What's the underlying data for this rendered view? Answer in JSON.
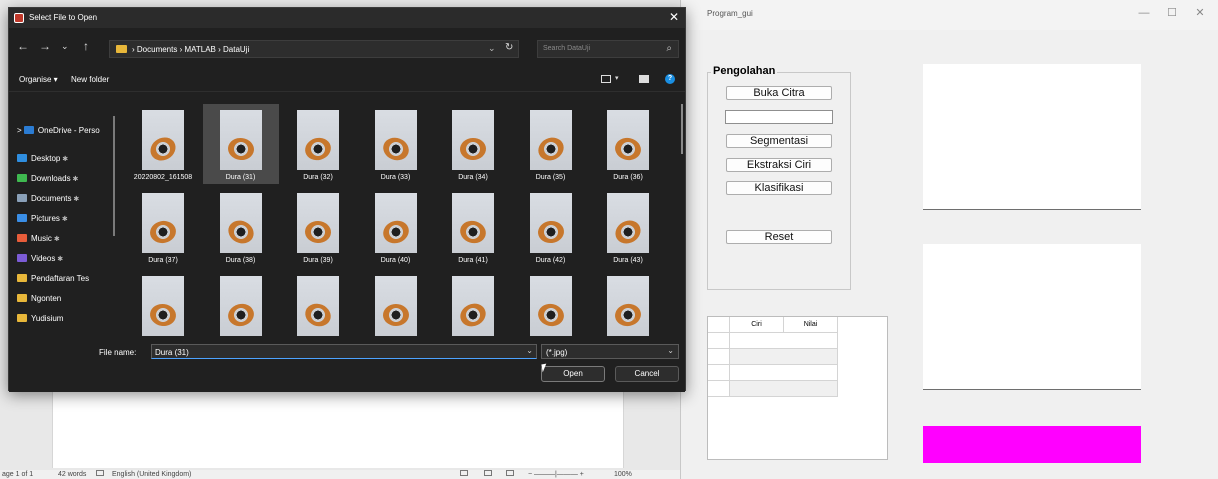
{
  "word": {
    "page_count": "age 1 of 1",
    "words": "42 words",
    "language": "English (United Kingdom)",
    "zoom": "100%"
  },
  "program": {
    "title": "Program_gui",
    "panel_title": "Pengolahan",
    "buttons": {
      "buka": "Buka Citra",
      "segmentasi": "Segmentasi",
      "ekstraksi": "Ekstraksi Ciri",
      "klasifikasi": "Klasifikasi",
      "reset": "Reset"
    },
    "table": {
      "col_ciri": "Ciri",
      "col_nilai": "Nilai"
    },
    "accent_color": "#ff00ff"
  },
  "dialog": {
    "title": "Select File to Open",
    "path": [
      "Documents",
      "MATLAB",
      "DataUji"
    ],
    "search_placeholder": "Search DataUji",
    "organise": "Organise ▾",
    "new_folder": "New folder",
    "nav_items": [
      {
        "label": "OneDrive - Perso",
        "icon": "cloud-icon",
        "color": "#2b7cd3"
      },
      {
        "label": "Desktop",
        "icon": "desktop-icon",
        "color": "#2f8ee0"
      },
      {
        "label": "Downloads",
        "icon": "download-icon",
        "color": "#3fb950"
      },
      {
        "label": "Documents",
        "icon": "document-icon",
        "color": "#8aa0b8"
      },
      {
        "label": "Pictures",
        "icon": "pictures-icon",
        "color": "#3a8ee6"
      },
      {
        "label": "Music",
        "icon": "music-icon",
        "color": "#e85d3a"
      },
      {
        "label": "Videos",
        "icon": "video-icon",
        "color": "#7c5cd6"
      },
      {
        "label": "Pendaftaran Tes",
        "icon": "folder-icon",
        "color": "#e8b73a"
      },
      {
        "label": "Ngonten",
        "icon": "folder-icon",
        "color": "#e8b73a"
      },
      {
        "label": "Yudisium",
        "icon": "folder-icon",
        "color": "#e8b73a"
      }
    ],
    "files": [
      "20220802_161508",
      "Dura (31)",
      "Dura (32)",
      "Dura (33)",
      "Dura (34)",
      "Dura (35)",
      "Dura (36)",
      "Dura (37)",
      "Dura (38)",
      "Dura (39)",
      "Dura (40)",
      "Dura (41)",
      "Dura (42)",
      "Dura (43)",
      "",
      "",
      "",
      "",
      "",
      "",
      ""
    ],
    "selected_file": "Dura (31)",
    "file_name_label": "File name:",
    "file_name_value": "Dura (31)",
    "file_type": "(*.jpg)",
    "open_label": "Open",
    "cancel_label": "Cancel"
  }
}
